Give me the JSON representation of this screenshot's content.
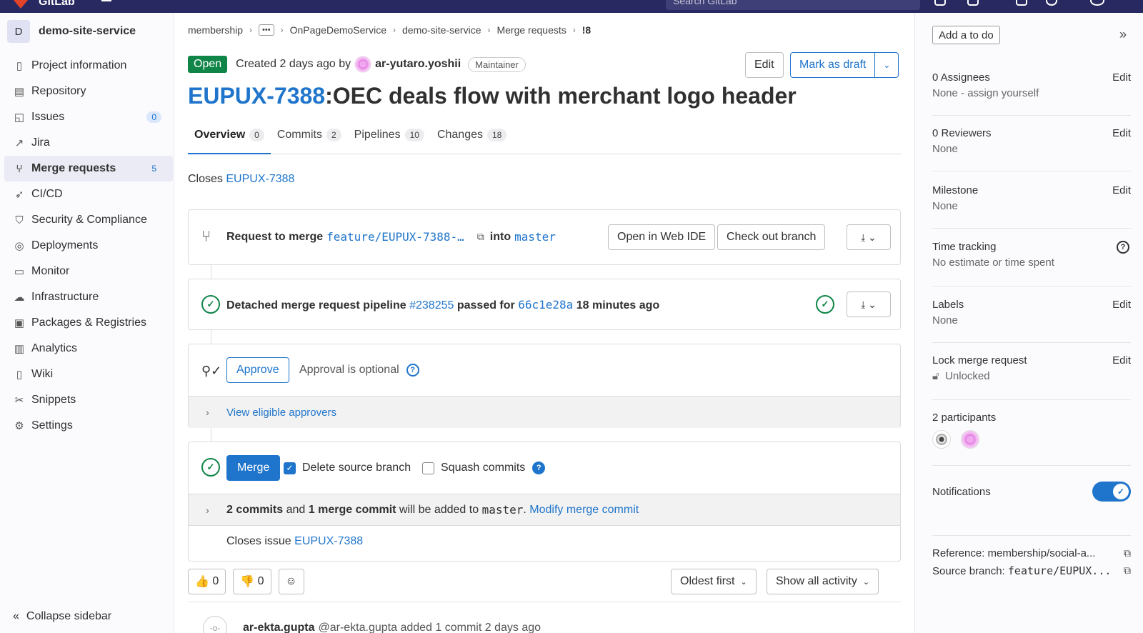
{
  "topbar": {
    "brand": "GitLab",
    "search_placeholder": "Search GitLab"
  },
  "sidebar": {
    "project_initial": "D",
    "project_name": "demo-site-service",
    "items": [
      {
        "label": "Project information",
        "icon": "info-icon"
      },
      {
        "label": "Repository",
        "icon": "repository-icon"
      },
      {
        "label": "Issues",
        "icon": "issues-icon",
        "count": "0"
      },
      {
        "label": "Jira",
        "icon": "external-link-icon"
      },
      {
        "label": "Merge requests",
        "icon": "merge-request-icon",
        "count": "5",
        "active": true
      },
      {
        "label": "CI/CD",
        "icon": "rocket-icon"
      },
      {
        "label": "Security & Compliance",
        "icon": "shield-icon"
      },
      {
        "label": "Deployments",
        "icon": "deployments-icon"
      },
      {
        "label": "Monitor",
        "icon": "monitor-icon"
      },
      {
        "label": "Infrastructure",
        "icon": "cloud-icon"
      },
      {
        "label": "Packages & Registries",
        "icon": "package-icon"
      },
      {
        "label": "Analytics",
        "icon": "chart-icon"
      },
      {
        "label": "Wiki",
        "icon": "book-icon"
      },
      {
        "label": "Snippets",
        "icon": "scissors-icon"
      },
      {
        "label": "Settings",
        "icon": "gear-icon"
      }
    ],
    "collapse_label": "Collapse sidebar"
  },
  "breadcrumb": {
    "items": [
      "membership",
      "OnPageDemoService",
      "demo-site-service",
      "Merge requests",
      "!8"
    ]
  },
  "mr": {
    "status": "Open",
    "created_text": "Created 2 days ago by",
    "author": "ar-yutaro.yoshii",
    "role": "Maintainer",
    "edit_label": "Edit",
    "draft_label": "Mark as draft",
    "title_issue": "EUPUX-7388",
    "title_text": ":OEC deals flow with merchant logo header",
    "tabs": [
      {
        "label": "Overview",
        "count": "0",
        "active": true
      },
      {
        "label": "Commits",
        "count": "2"
      },
      {
        "label": "Pipelines",
        "count": "10"
      },
      {
        "label": "Changes",
        "count": "18"
      }
    ],
    "closes_prefix": "Closes",
    "closes_issue": "EUPUX-7388"
  },
  "request_card": {
    "prefix": "Request to merge",
    "source_branch": "feature/EUPUX-7388-…",
    "into": "into",
    "target_branch": "master",
    "web_ide_label": "Open in Web IDE",
    "checkout_label": "Check out branch"
  },
  "pipeline_card": {
    "prefix": "Detached merge request pipeline",
    "pipeline_id": "#238255",
    "passed_for": "passed for",
    "commit": "66c1e28a",
    "time": "18 minutes ago"
  },
  "approval_card": {
    "approve_label": "Approve",
    "optional_text": "Approval is optional",
    "eligible_label": "View eligible approvers"
  },
  "merge_card": {
    "merge_label": "Merge",
    "delete_branch_label": "Delete source branch",
    "delete_branch_checked": true,
    "squash_label": "Squash commits",
    "squash_checked": false,
    "commits_bold": "2 commits",
    "and": "and",
    "merge_commit_bold": "1 merge commit",
    "added_to": "will be added to",
    "target_branch": "master",
    "period": ".",
    "modify_label": "Modify merge commit",
    "closes_prefix": "Closes issue",
    "closes_issue": "EUPUX-7388"
  },
  "reactions": {
    "thumbs_up": "👍",
    "thumbs_up_count": "0",
    "thumbs_down": "👎",
    "thumbs_down_count": "0"
  },
  "sort": {
    "order_label": "Oldest first",
    "filter_label": "Show all activity"
  },
  "activity": {
    "author": "ar-ekta.gupta",
    "handle": "@ar-ekta.gupta",
    "text": "added 1 commit 2 days ago"
  },
  "right_sidebar": {
    "todo_label": "Add a to do",
    "assignees_title": "0 Assignees",
    "assignees_value": "None - assign yourself",
    "reviewers_title": "0 Reviewers",
    "reviewers_value": "None",
    "milestone_title": "Milestone",
    "milestone_value": "None",
    "time_title": "Time tracking",
    "time_value": "No estimate or time spent",
    "labels_title": "Labels",
    "labels_value": "None",
    "lock_title": "Lock merge request",
    "lock_value": "Unlocked",
    "participants_title": "2 participants",
    "notifications_title": "Notifications",
    "notifications_on": true,
    "edit_label": "Edit",
    "reference_label": "Reference: membership/social-a...",
    "source_branch_label": "Source branch:",
    "source_branch_value": "feature/EUPUX..."
  },
  "colors": {
    "accent": "#1f75cb",
    "success": "#108548",
    "topbar": "#292961"
  }
}
